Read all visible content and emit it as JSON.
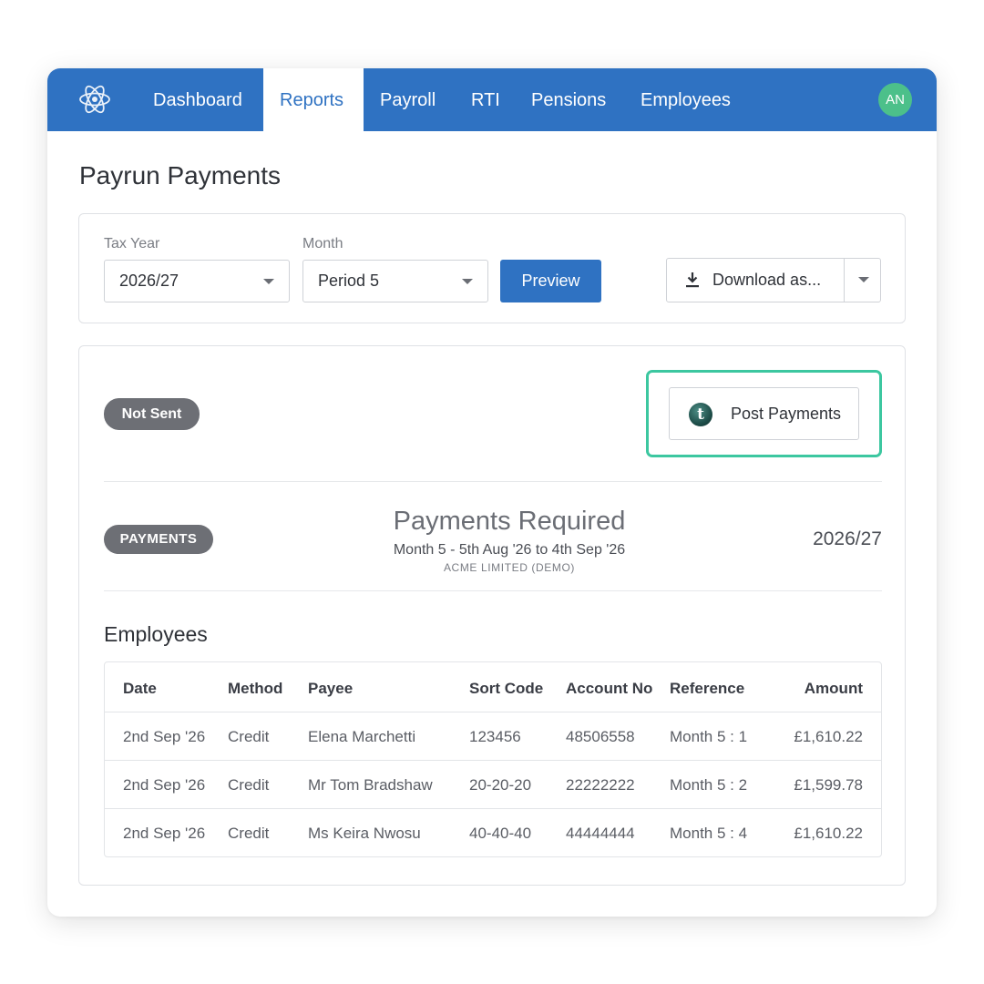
{
  "nav": {
    "items": [
      {
        "label": "Dashboard",
        "active": false
      },
      {
        "label": "Reports",
        "active": true
      },
      {
        "label": "Payroll",
        "active": false
      },
      {
        "label": "RTI",
        "active": false
      },
      {
        "label": "Pensions",
        "active": false
      },
      {
        "label": "Employees",
        "active": false
      }
    ],
    "avatar_initials": "AN",
    "logo_icon": "atom-icon"
  },
  "page": {
    "title": "Payrun Payments"
  },
  "filters": {
    "tax_year_label": "Tax Year",
    "tax_year_value": "2026/27",
    "month_label": "Month",
    "month_value": "Period 5",
    "preview_label": "Preview",
    "download_label": "Download as..."
  },
  "status": {
    "badge": "Not Sent",
    "post_payments_label": "Post Payments"
  },
  "report": {
    "badge": "PAYMENTS",
    "title": "Payments Required",
    "subtitle": "Month 5 - 5th Aug '26 to 4th Sep '26",
    "company": "ACME LIMITED (DEMO)",
    "year": "2026/27"
  },
  "employees": {
    "title": "Employees",
    "columns": [
      "Date",
      "Method",
      "Payee",
      "Sort Code",
      "Account No",
      "Reference",
      "Amount"
    ],
    "rows": [
      [
        "2nd Sep '26",
        "Credit",
        "Elena Marchetti",
        "123456",
        "48506558",
        "Month 5 : 1",
        "£1,610.22"
      ],
      [
        "2nd Sep '26",
        "Credit",
        "Mr Tom Bradshaw",
        "20-20-20",
        "22222222",
        "Month 5 : 2",
        "£1,599.78"
      ],
      [
        "2nd Sep '26",
        "Credit",
        "Ms Keira Nwosu",
        "40-40-40",
        "44444444",
        "Month 5 : 4",
        "£1,610.22"
      ]
    ]
  },
  "colors": {
    "nav_blue": "#2f72c2",
    "avatar_green": "#4cc08a",
    "highlight_green": "#3cc7a0",
    "badge_gray": "#6d6f75"
  }
}
